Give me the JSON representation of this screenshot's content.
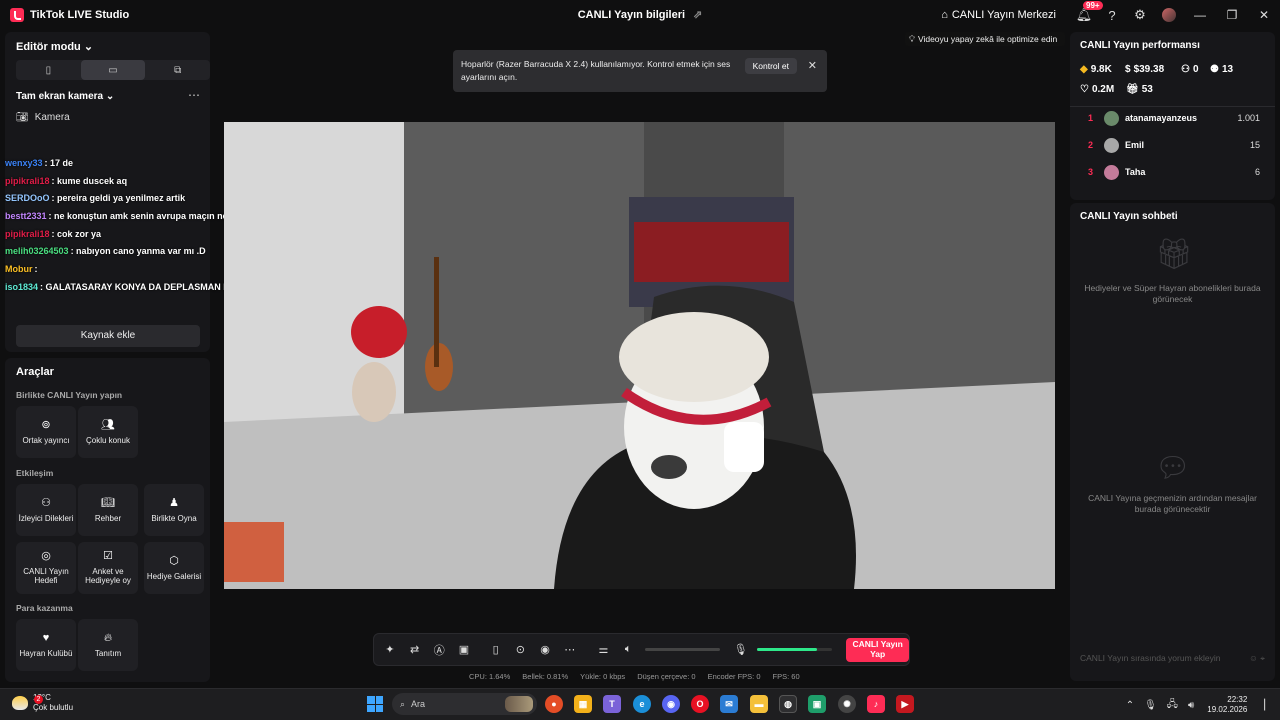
{
  "titlebar": {
    "app_name": "TikTok LIVE Studio",
    "center_title": "CANLI Yayın bilgileri",
    "live_center": "CANLI Yayın Merkezi",
    "notification_badge": "99+"
  },
  "left": {
    "editor_mode": "Editör modu",
    "camera_scene": "Tam ekran kamera",
    "camera_source": "Kamera",
    "add_source": "Kaynak ekle"
  },
  "chat_overlay": [
    {
      "nick": "wenxy33",
      "msg": ": 17 de",
      "color": "#3b82f6"
    },
    {
      "nick": "pipikrali18",
      "msg": ": kume duscek aq",
      "color": "#e11d48"
    },
    {
      "nick": "SERDOoO",
      "msg": ": pereira geldi ya yenilmez artik",
      "color": "#93c5fd"
    },
    {
      "nick": "bestt2331",
      "msg": ": ne konuştun amk senin avrupa maçın nerde",
      "color": "#c084fc"
    },
    {
      "nick": "pipikrali18",
      "msg": ": cok zor ya",
      "color": "#e11d48"
    },
    {
      "nick": "melih03264503",
      "msg": ": nabıyon cano yanma var mı .D",
      "color": "#4ade80"
    },
    {
      "nick": "Mobur",
      "msg": ":",
      "color": "#fbbf24"
    },
    {
      "nick": "iso1834",
      "msg": ": GALATASARAY KONYA DA DEPLASMAN PUAN KAYBI İZLEEE",
      "color": "#5eead4"
    }
  ],
  "tools": {
    "title": "Araçlar",
    "section_together": "Birlikte CANLI Yayın yapın",
    "section_interaction": "Etkileşim",
    "section_monetize": "Para kazanma",
    "co_host": "Ortak yayıncı",
    "multi_guest": "Çoklu konuk",
    "viewer_requests": "İzleyici Dilekleri",
    "guide": "Rehber",
    "play_together": "Birlikte Oyna",
    "live_goal": "CANLI Yayın Hedefi",
    "poll": "Anket ve Hediyeyle oy",
    "gift_gallery": "Hediye Galerisi",
    "fan_club": "Hayran Kulübü",
    "promote": "Tanıtım"
  },
  "toast": {
    "message": "Hoparlör (Razer Barracuda X 2.4) kullanılamıyor. Kontrol etmek için ses ayarlarını açın.",
    "action": "Kontrol et"
  },
  "optimize_hint": "Videoyu yapay zekâ ile optimize edin",
  "controls": {
    "go_live": "CANLI Yayın Yap",
    "mic_level": 0.8
  },
  "stats": {
    "cpu": "CPU:  1.64%",
    "memory": "Bellek:  0.81%",
    "upload": "Yükle:  0 kbps",
    "dropped": "Düşen çerçeve:  0",
    "encoder_fps": "Encoder FPS:  0",
    "fps": "FPS:  60"
  },
  "performance": {
    "title": "CANLI Yayın performansı",
    "coins": "9.8K",
    "earnings": "$39.38",
    "viewers": "0",
    "followers": "13",
    "likes": "0.2M",
    "gifts": "53",
    "ranking": [
      {
        "rank": "1",
        "name": "atanamayanzeus",
        "value": "1.001"
      },
      {
        "rank": "2",
        "name": "Emil",
        "value": "15"
      },
      {
        "rank": "3",
        "name": "Taha",
        "value": "6"
      }
    ]
  },
  "live_chat": {
    "title": "CANLI Yayın sohbeti",
    "gifts_empty": "Hediyeler ve Süper Hayran abonelikleri burada görünecek",
    "messages_empty": "CANLI Yayına geçmenizin ardından mesajlar burada görünecektir",
    "input_placeholder": "CANLI Yayın sırasında yorum ekleyin"
  },
  "taskbar": {
    "temperature": "12°C",
    "weather": "Çok bulutlu",
    "weather_badge": "2",
    "search": "Ara",
    "time": "22:32",
    "date": "19.02.2026"
  }
}
